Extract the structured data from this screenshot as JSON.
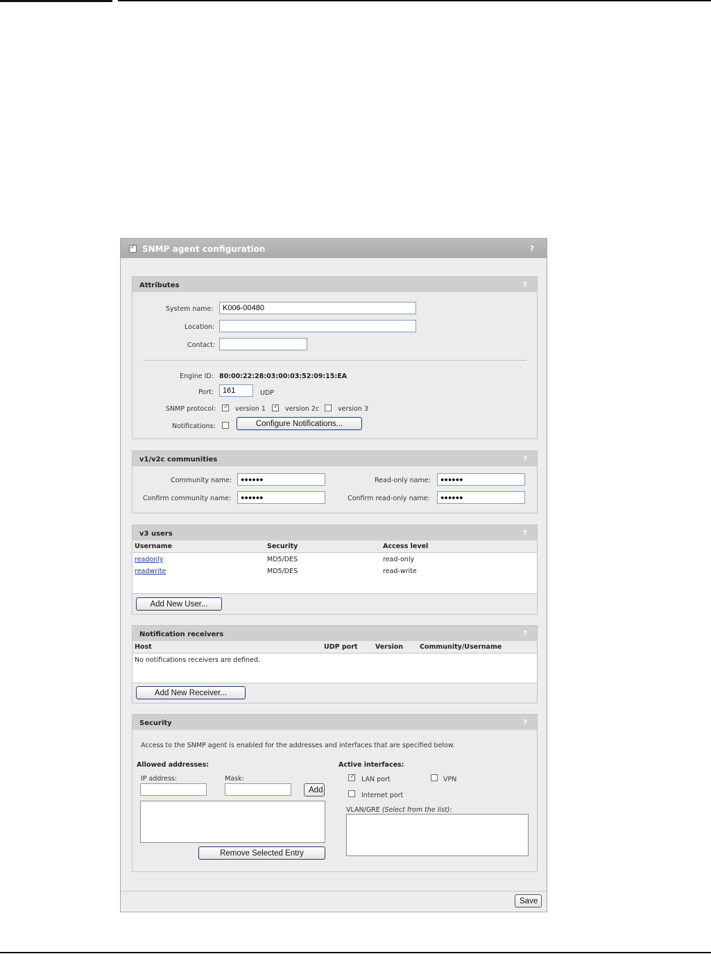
{
  "dialog": {
    "title": "SNMP agent configuration",
    "help": "?",
    "enabled": true,
    "save_label": "Save"
  },
  "attributes": {
    "title": "Attributes",
    "help": "?",
    "system_name_label": "System name:",
    "system_name_value": "K006-00480",
    "location_label": "Location:",
    "location_value": "",
    "contact_label": "Contact:",
    "contact_value": "",
    "engine_id_label": "Engine ID:",
    "engine_id_value": "80:00:22:28:03:00:03:52:09:15:EA",
    "port_label": "Port:",
    "port_value": "161",
    "port_unit": "UDP",
    "snmp_protocol_label": "SNMP protocol:",
    "protocols": [
      {
        "label": "version 1",
        "checked": true
      },
      {
        "label": "version 2c",
        "checked": true
      },
      {
        "label": "version 3",
        "checked": false
      }
    ],
    "notifications_label": "Notifications:",
    "notifications_checked": false,
    "configure_notifications_label": "Configure Notifications..."
  },
  "communities": {
    "title": "v1/v2c communities",
    "help": "?",
    "community_name_label": "Community name:",
    "community_name_value": "●●●●●●",
    "confirm_community_label": "Confirm community name:",
    "confirm_community_value": "●●●●●●",
    "readonly_name_label": "Read-only name:",
    "readonly_name_value": "●●●●●●",
    "confirm_readonly_label": "Confirm read-only name:",
    "confirm_readonly_value": "●●●●●●"
  },
  "v3users": {
    "title": "v3 users",
    "help": "?",
    "columns": [
      "Username",
      "Security",
      "Access level"
    ],
    "rows": [
      {
        "username": "readonly",
        "security": "MD5/DES",
        "access": "read-only"
      },
      {
        "username": "readwrite",
        "security": "MD5/DES",
        "access": "read-write"
      }
    ],
    "add_label": "Add New User..."
  },
  "receivers": {
    "title": "Notification receivers",
    "help": "?",
    "columns": [
      "Host",
      "UDP port",
      "Version",
      "Community/Username"
    ],
    "empty_text": "No notifications receivers are defined.",
    "add_label": "Add New Receiver..."
  },
  "security": {
    "title": "Security",
    "help": "?",
    "intro": "Access to the SNMP agent is enabled for the addresses and interfaces that are specified below.",
    "allowed_label": "Allowed addresses:",
    "ip_label": "IP address:",
    "mask_label": "Mask:",
    "add_label": "Add",
    "remove_label": "Remove Selected Entry",
    "active_label": "Active interfaces:",
    "interfaces": [
      {
        "label": "LAN port",
        "checked": true
      },
      {
        "label": "VPN",
        "checked": false
      },
      {
        "label": "Internet port",
        "checked": false
      }
    ],
    "vlan_label": "VLAN/GRE",
    "vlan_hint": "(Select from the list):"
  }
}
